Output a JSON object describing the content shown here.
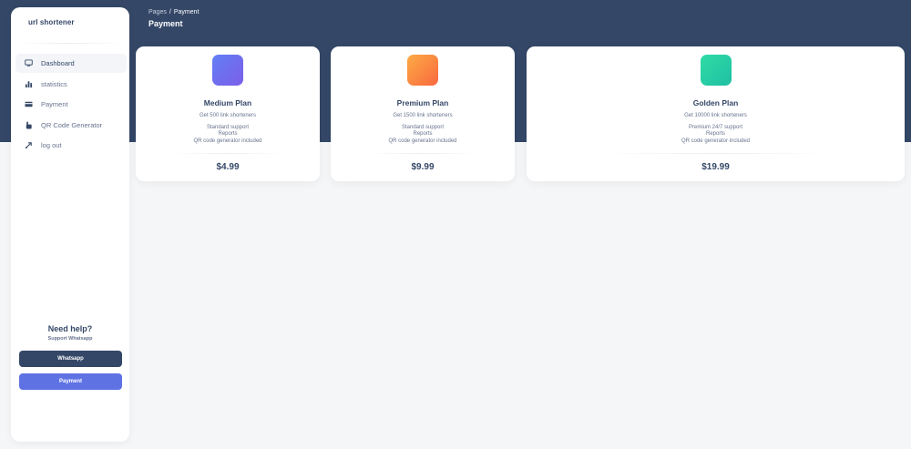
{
  "brand": "url shortener",
  "sidebar": {
    "items": [
      {
        "label": "Dashboard",
        "icon": "monitor-icon",
        "active": true
      },
      {
        "label": "statistics",
        "icon": "bar-chart-icon",
        "active": false
      },
      {
        "label": "Payment",
        "icon": "credit-card-icon",
        "active": false
      },
      {
        "label": "QR Code Generator",
        "icon": "pointer-hand-icon",
        "active": false
      },
      {
        "label": "log out",
        "icon": "logout-icon",
        "active": false
      }
    ],
    "help_title": "Need help?",
    "help_subtitle": "Support Whatsapp",
    "whatsapp_label": "Whatsapp",
    "payment_label": "Payment"
  },
  "header": {
    "breadcrumb_root": "Pages",
    "breadcrumb_sep": "/",
    "breadcrumb_current": "Payment",
    "title": "Payment"
  },
  "plans": [
    {
      "name": "Medium Plan",
      "links": "Get 500 link shorteners",
      "features": [
        "Standard support",
        "Reports",
        "QR code generator included"
      ],
      "price": "$4.99"
    },
    {
      "name": "Premium Plan",
      "links": "Get 1500 link shorteners",
      "features": [
        "Standard support",
        "Reports",
        "QR code generator included"
      ],
      "price": "$9.99"
    },
    {
      "name": "Golden Plan",
      "links": "Get 10000 link shorteners",
      "features": [
        "Premium 24/7 support",
        "Reports",
        "QR code generator included"
      ],
      "price": "$19.99"
    }
  ],
  "colors": {
    "primary_dark": "#344767",
    "accent": "#5e72e4",
    "text_muted": "#67748e"
  }
}
